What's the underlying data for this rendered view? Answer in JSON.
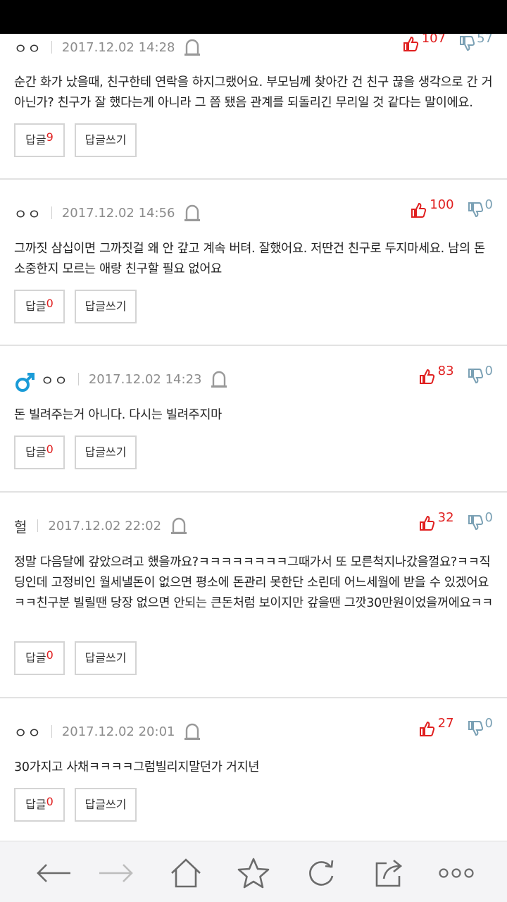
{
  "comments": [
    {
      "author": "ㅇㅇ",
      "date": "2017.12.02 14:28",
      "up": "107",
      "down": "57",
      "body": "순간 화가 났을때, 친구한테 연락을 하지그랬어요. 부모님께 찾아간 건 친구 끊을 생각으로 간 거 아닌가? 친구가 잘 했다는게 아니라 그 쯤 됐음 관계를 되돌리긴 무리일 것 같다는 말이에요.",
      "reply_label": "답글",
      "reply_count": "9",
      "write_label": "답글쓰기"
    },
    {
      "author": "ㅇㅇ",
      "date": "2017.12.02 14:56",
      "up": "100",
      "down": "0",
      "body": "그까짓 삼십이면 그까짓걸 왜 안 갚고 계속 버텨. 잘했어요. 저딴건 친구로 두지마세요. 남의 돈 소중한지 모르는 애랑 친구할 필요 없어요",
      "reply_label": "답글",
      "reply_count": "0",
      "write_label": "답글쓰기"
    },
    {
      "author": "ㅇㅇ",
      "date": "2017.12.02 14:23",
      "up": "83",
      "down": "0",
      "body": "돈 빌려주는거 아니다. 다시는 빌려주지마",
      "reply_label": "답글",
      "reply_count": "0",
      "write_label": "답글쓰기"
    },
    {
      "author": "헐",
      "date": "2017.12.02 22:02",
      "up": "32",
      "down": "0",
      "body": "정말 다음달에 갚았으려고 했을까요?ㅋㅋㅋㅋㅋㅋㅋㅋ그때가서 또 모른척지나갔을껄요?ㅋㅋ직딩인데 고정비인 월세낼돈이 없으면 평소에 돈관리 못한단 소린데 어느세월에 받을 수 있겠어요ㅋㅋ친구분 빌릴땐 당장 없으면 안되는 큰돈처럼 보이지만 갚을땐 그깟30만원이었을꺼에요ㅋㅋ",
      "reply_label": "답글",
      "reply_count": "0",
      "write_label": "답글쓰기"
    },
    {
      "author": "ㅇㅇ",
      "date": "2017.12.02 20:01",
      "up": "27",
      "down": "0",
      "body": "30가지고 사채ㅋㅋㅋㅋ그럼빌리지말던가 거지년",
      "reply_label": "답글",
      "reply_count": "0",
      "write_label": "답글쓰기"
    }
  ],
  "icons": {
    "up_color": "#e02020",
    "down_color": "#7aa0b4",
    "male_color": "#1a9bd7"
  },
  "toolbar": [
    "back-arrow-icon",
    "forward-arrow-icon",
    "home-icon",
    "star-icon",
    "refresh-icon",
    "share-icon",
    "more-icon"
  ]
}
